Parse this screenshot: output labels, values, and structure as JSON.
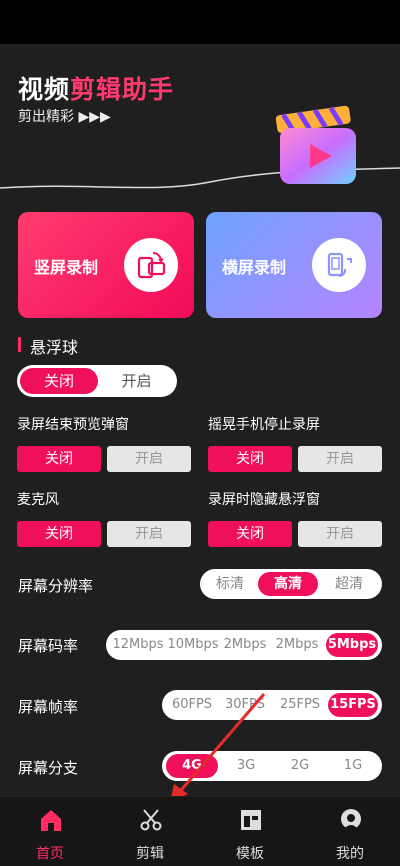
{
  "hero": {
    "title_white": "视频",
    "title_pink": "剪辑助手",
    "subtitle": "剪出精彩 ▶▶▶"
  },
  "cards": {
    "vertical_label": "竖屏录制",
    "horizontal_label": "横屏录制"
  },
  "float_ball": {
    "section_title": "悬浮球",
    "on_label": "关闭",
    "off_label": "开启"
  },
  "options": [
    {
      "label": "录屏结束预览弹窗",
      "on": "关闭",
      "off": "开启"
    },
    {
      "label": "摇晃手机停止录屏",
      "on": "关闭",
      "off": "开启"
    },
    {
      "label": "麦克风",
      "on": "关闭",
      "off": "开启"
    },
    {
      "label": "录屏时隐藏悬浮窗",
      "on": "关闭",
      "off": "开启"
    }
  ],
  "resolution": {
    "label": "屏幕分辨率",
    "options": [
      "标清",
      "高清",
      "超清"
    ],
    "selected": "高清"
  },
  "bitrate": {
    "label": "屏幕码率",
    "options": [
      "12Mbps",
      "10Mbps",
      "2Mbps",
      "2Mbps",
      "5Mbps"
    ],
    "selected": "5Mbps"
  },
  "framerate": {
    "label": "屏幕帧率",
    "options": [
      "60FPS",
      "30FPS",
      "25FPS",
      "15FPS"
    ],
    "selected": "15FPS"
  },
  "branch": {
    "label": "屏幕分支",
    "options": [
      "4G",
      "3G",
      "2G",
      "1G"
    ],
    "selected": "4G"
  },
  "nav": {
    "home": "首页",
    "edit": "剪辑",
    "template": "模板",
    "mine": "我的"
  },
  "colors": {
    "accent": "#f0105a",
    "card_vertical": "#ff3c6f",
    "card_horizontal": "#8e95ff"
  }
}
